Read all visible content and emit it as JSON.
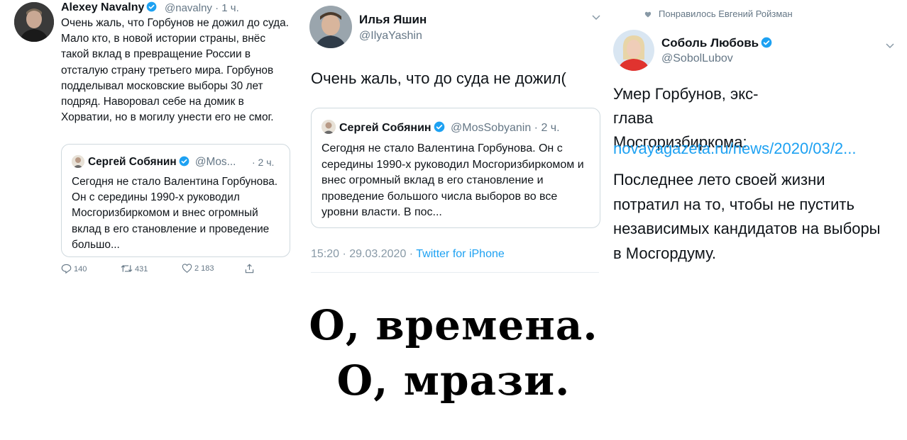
{
  "tweet_navalny": {
    "name": "Alexey Navalny",
    "handle_time": "@navalny · 1 ч.",
    "text": "Очень жаль, что Горбунов не дожил до суда. Мало кто, в новой истории страны, внёс такой вклад в превращение России в отсталую страну третьего мира. Горбунов подделывал московские выборы 30 лет подряд. Наворовал себе на домик в Хорватии, но в могилу унести его не смог.",
    "quote": {
      "name": "Сергей Собянин",
      "handle": "@Mos...",
      "time": "· 2 ч.",
      "text": "Сегодня не стало Валентина Горбунова. Он с середины 1990-х руководил Мосгоризбиркомом и внес огромный вклад в его становление и проведение большо..."
    },
    "actions": {
      "replies": "140",
      "retweets": "431",
      "likes": "2 183"
    }
  },
  "tweet_yashin": {
    "name": "Илья Яшин",
    "handle": "@IlyaYashin",
    "text": "Очень жаль, что до суда не дожил(",
    "quote": {
      "name": "Сергей Собянин",
      "handle_time": "@MosSobyanin · 2 ч.",
      "text": "Сегодня не стало Валентина Горбунова. Он с середины 1990-х руководил Мосгоризбиркомом и внес огромный вклад в его становление и проведение большого числа выборов во все уровни власти. В пос..."
    },
    "meta_time": "15:20 · 29.03.2020 · ",
    "meta_source": "Twitter for iPhone"
  },
  "tweet_sobol": {
    "liked_by": "Понравилось Евгений Ройзман",
    "name": "Соболь Любовь",
    "handle": "@SobolLubov",
    "text_1": "Умер Горбунов, экс-глава Мосгоризбиркома:",
    "link": "novayagazeta.ru/news/2020/03/2...",
    "text_2": "Последнее лето своей жизни потратил на то, чтобы не пустить независимых кандидатов на выборы в Мосгордуму."
  },
  "caption": {
    "line_1": "О, времена.",
    "line_2": "О, мрази."
  },
  "colors": {
    "twitter_blue": "#1da1f2",
    "secondary_text": "#657786",
    "primary_text": "#0f1419"
  }
}
